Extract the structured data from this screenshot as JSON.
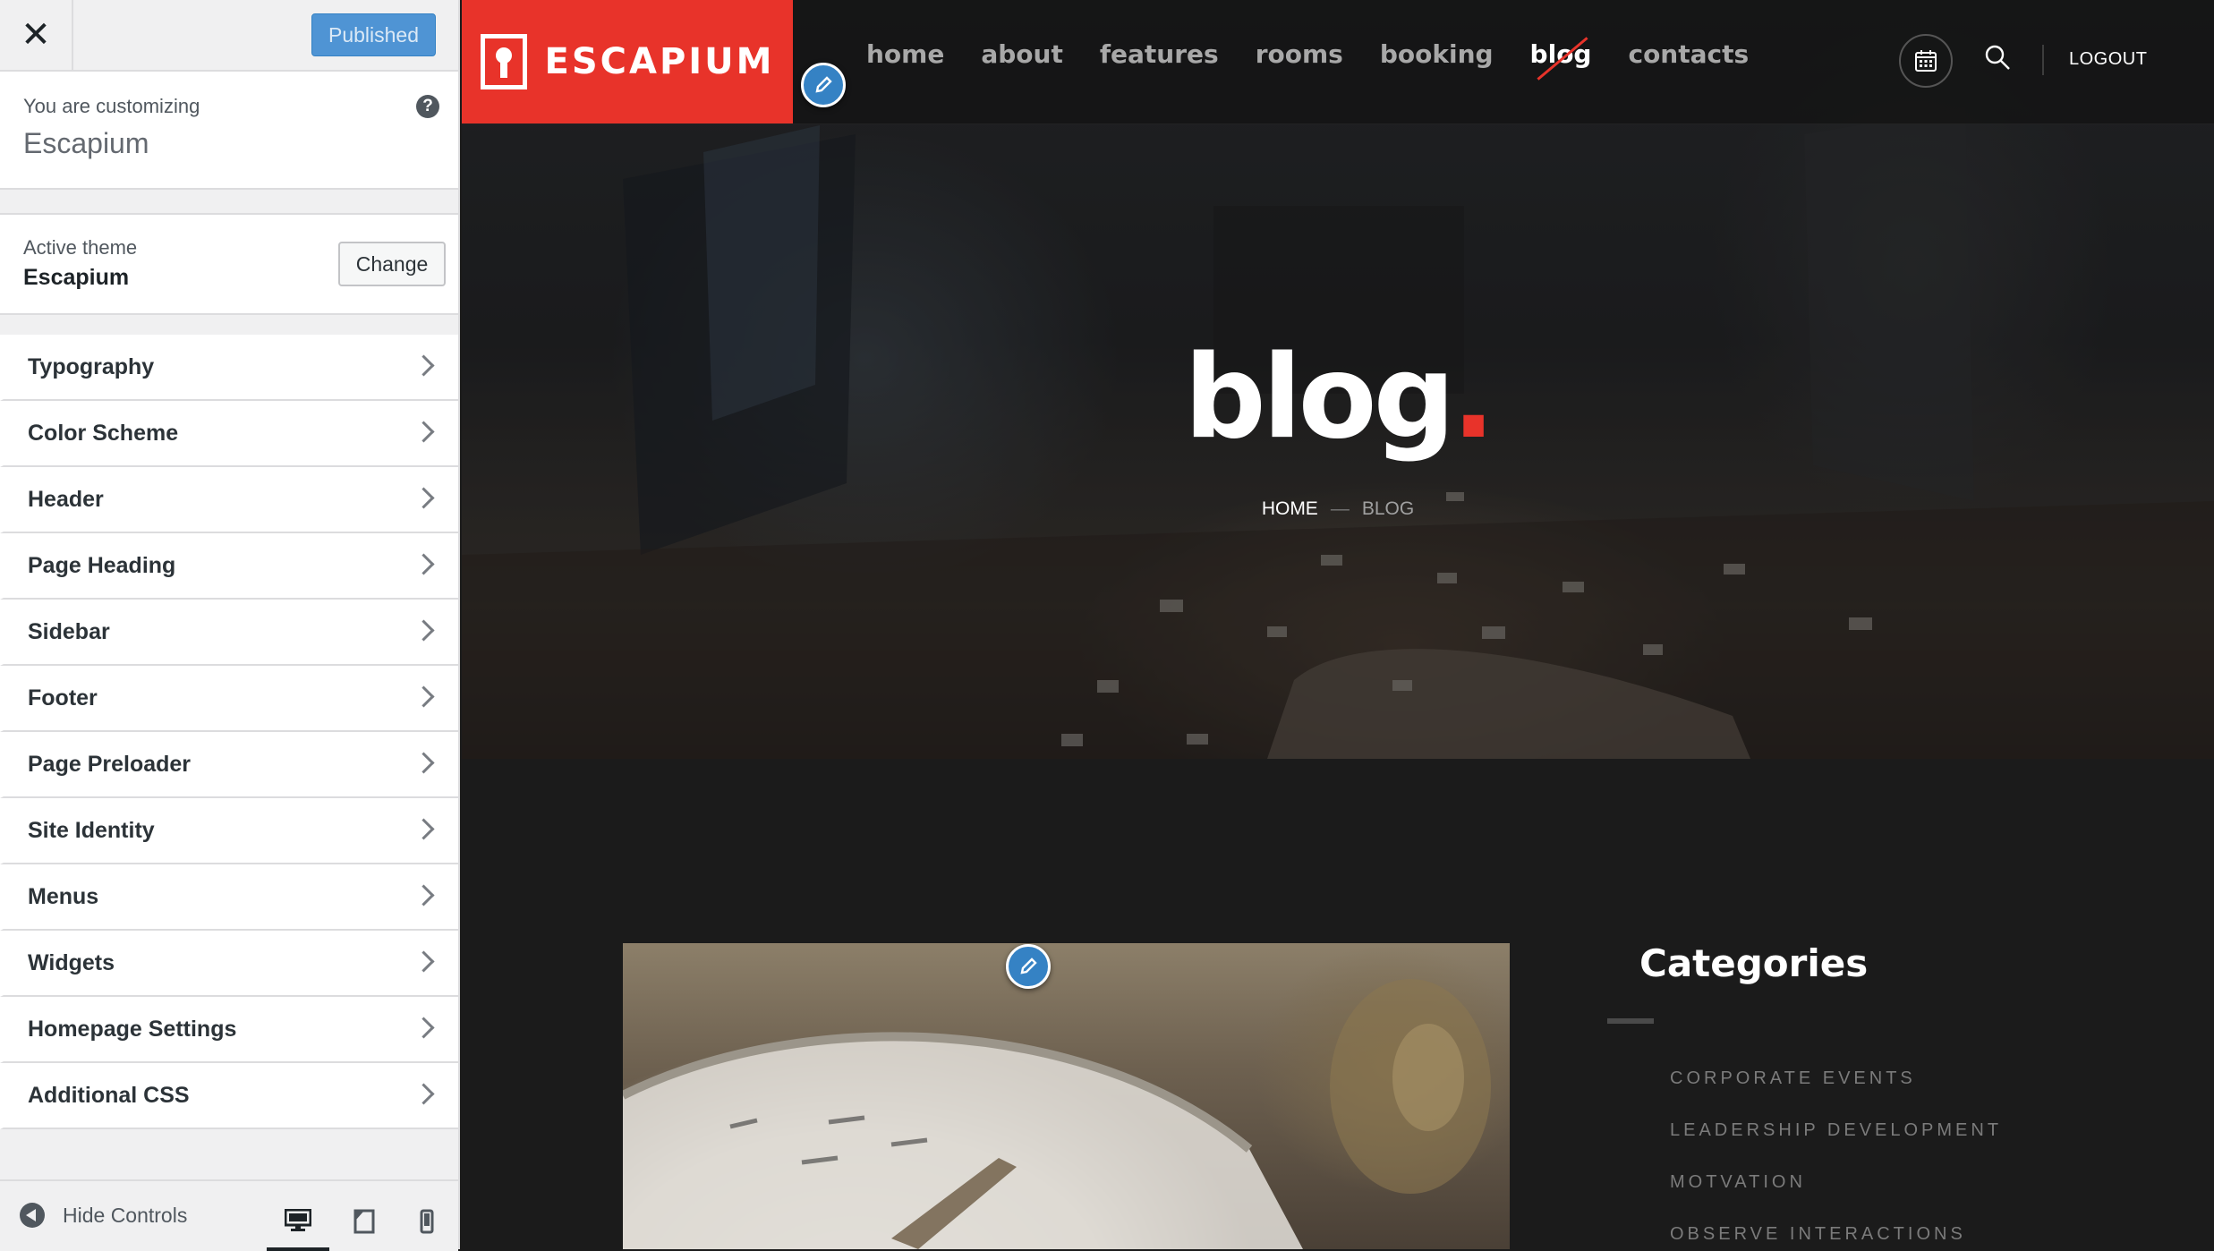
{
  "customizer": {
    "publish_label": "Published",
    "you_are_customizing": "You are customizing",
    "site_name": "Escapium",
    "active_theme_label": "Active theme",
    "active_theme_name": "Escapium",
    "change_label": "Change",
    "sections": [
      {
        "label": "Typography"
      },
      {
        "label": "Color Scheme"
      },
      {
        "label": "Header"
      },
      {
        "label": "Page Heading"
      },
      {
        "label": "Sidebar"
      },
      {
        "label": "Footer"
      },
      {
        "label": "Page Preloader"
      },
      {
        "label": "Site Identity"
      },
      {
        "label": "Menus"
      },
      {
        "label": "Widgets"
      },
      {
        "label": "Homepage Settings"
      },
      {
        "label": "Additional CSS"
      }
    ],
    "hide_controls_label": "Hide Controls",
    "active_device": "desktop"
  },
  "site": {
    "logo_text": "ESCAPIUM",
    "nav": [
      {
        "label": "home"
      },
      {
        "label": "about"
      },
      {
        "label": "features"
      },
      {
        "label": "rooms"
      },
      {
        "label": "booking"
      },
      {
        "label": "blog",
        "current": true
      },
      {
        "label": "contacts"
      }
    ],
    "logout_label": "LOGOUT",
    "hero_title": "blog",
    "hero_dot": ".",
    "breadcrumb_home": "HOME",
    "breadcrumb_sep": "—",
    "breadcrumb_current": "BLOG",
    "categories_title": "Categories",
    "categories": [
      "CORPORATE EVENTS",
      "LEADERSHIP DEVELOPMENT",
      "MOTVATION",
      "OBSERVE INTERACTIONS"
    ]
  },
  "colors": {
    "accent": "#e8332a",
    "wp_blue": "#3582c4"
  }
}
